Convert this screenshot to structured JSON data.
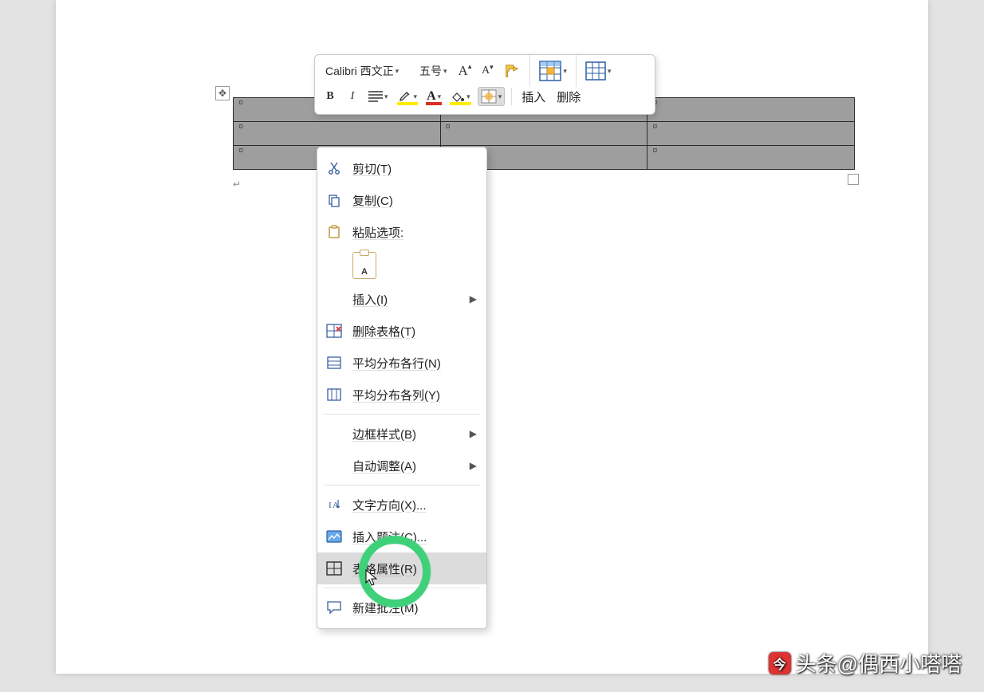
{
  "toolbar": {
    "font_name": "Calibri 西文正",
    "font_size": "五号",
    "grow_font": "A",
    "shrink_font": "A",
    "bold": "B",
    "italic": "I",
    "insert_label": "插入",
    "delete_label": "删除"
  },
  "table": {
    "rows": 3,
    "cols": 3,
    "cell_marker": "¤"
  },
  "context_menu": {
    "cut": "剪切(T)",
    "copy": "复制(C)",
    "paste_options": "粘贴选项:",
    "paste_keep_text": "A",
    "insert": "插入(I)",
    "delete_table": "删除表格(T)",
    "distribute_rows": "平均分布各行(N)",
    "distribute_cols": "平均分布各列(Y)",
    "border_styles": "边框样式(B)",
    "autofit": "自动调整(A)",
    "text_direction": "文字方向(X)...",
    "insert_caption": "插入题注(C)...",
    "table_properties": "表格属性(R)",
    "new_comment": "新建批注(M)"
  },
  "watermark": {
    "text": "头条@偶西小嗒嗒"
  }
}
